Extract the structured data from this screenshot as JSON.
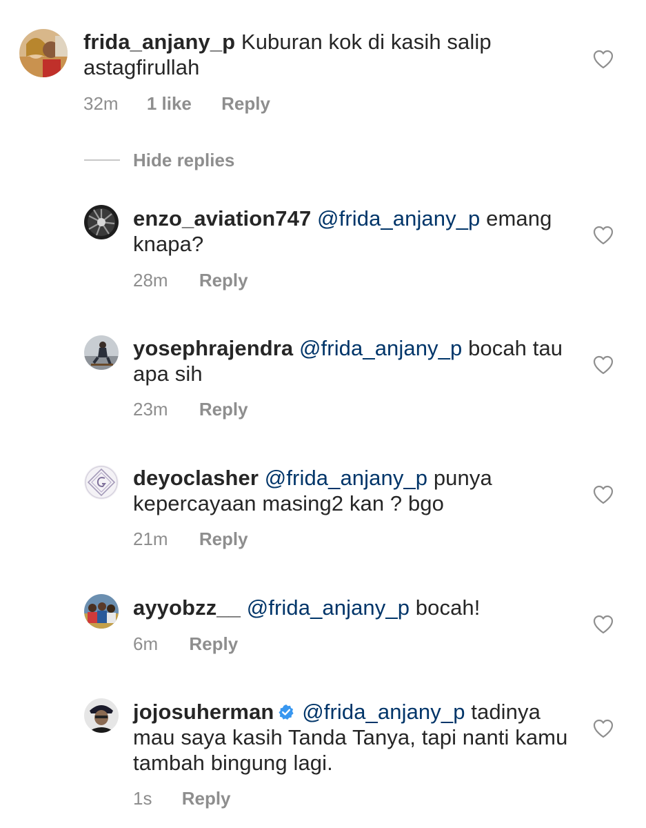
{
  "comment": {
    "username": "frida_anjany_p",
    "text": "Kuburan kok di kasih salip astagfirullah",
    "time": "32m",
    "likes": "1 like",
    "reply_label": "Reply"
  },
  "hide_replies_label": "Hide replies",
  "replies": [
    {
      "username": "enzo_aviation747",
      "mention": "@frida_anjany_p",
      "text": "emang knapa?",
      "time": "28m",
      "reply_label": "Reply",
      "verified": false
    },
    {
      "username": "yosephrajendra",
      "mention": "@frida_anjany_p",
      "text": "bocah tau apa sih",
      "time": "23m",
      "reply_label": "Reply",
      "verified": false
    },
    {
      "username": "deyoclasher",
      "mention": "@frida_anjany_p",
      "text": "punya kepercayaan masing2 kan ? bgo",
      "time": "21m",
      "reply_label": "Reply",
      "verified": false
    },
    {
      "username": "ayyobzz__",
      "mention": "@frida_anjany_p",
      "text": "bocah!",
      "time": "6m",
      "reply_label": "Reply",
      "verified": false
    },
    {
      "username": "jojosuherman",
      "mention": "@frida_anjany_p",
      "text": "tadinya mau saya kasih Tanda Tanya, tapi nanti kamu tambah bingung lagi.",
      "time": "1s",
      "reply_label": "Reply",
      "verified": true
    }
  ],
  "colors": {
    "text": "#262626",
    "mention": "#003569",
    "meta": "#8e8e8e",
    "verified": "#3897f0"
  }
}
